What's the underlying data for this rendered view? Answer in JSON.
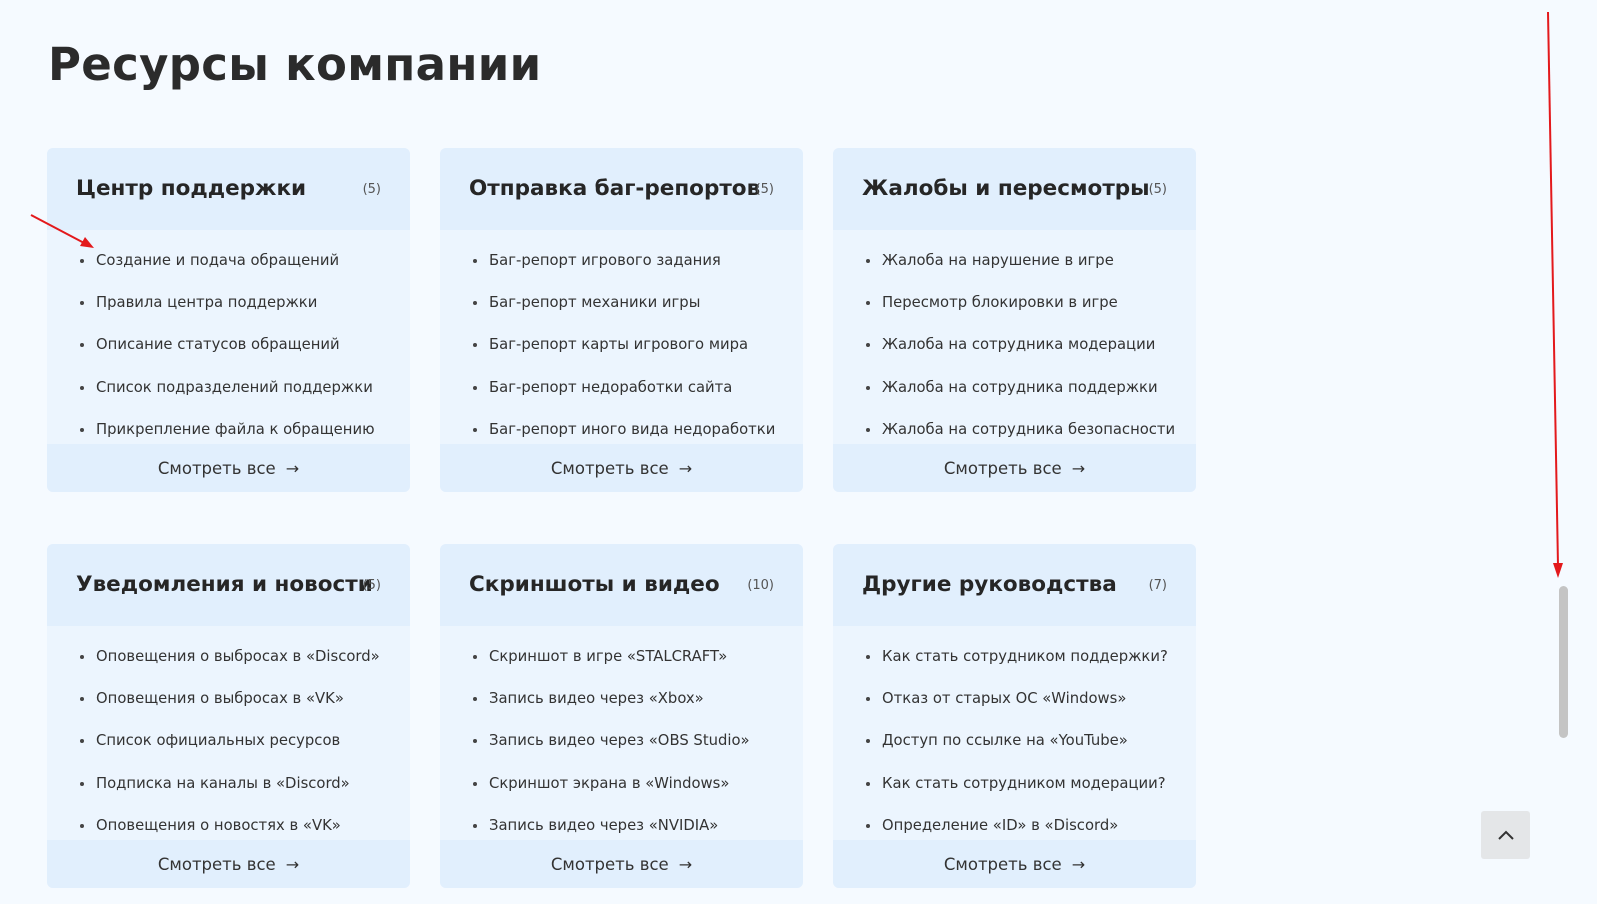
{
  "page": {
    "title": "Ресурсы компании"
  },
  "colors": {
    "background": "#f5faff",
    "card": "#ecf5fe",
    "card_header": "#e1effd",
    "annotation_arrow": "#e3191c"
  },
  "cards": [
    {
      "title": "Центр поддержки",
      "count": "(5)",
      "items": [
        "Создание и подача обращений",
        "Правила центра поддержки",
        "Описание статусов обращений",
        "Список подразделений поддержки",
        "Прикрепление файла к обращению"
      ],
      "view_all": "Смотреть все",
      "arrow": "→"
    },
    {
      "title": "Отправка баг-репортов",
      "count": "(5)",
      "items": [
        "Баг-репорт игрового задания",
        "Баг-репорт механики игры",
        "Баг-репорт карты игрового мира",
        "Баг-репорт недоработки сайта",
        "Баг-репорт иного вида недоработки"
      ],
      "view_all": "Смотреть все",
      "arrow": "→"
    },
    {
      "title": "Жалобы и пересмотры",
      "count": "(5)",
      "items": [
        "Жалоба на нарушение в игре",
        "Пересмотр блокировки в игре",
        "Жалоба на сотрудника модерации",
        "Жалоба на сотрудника поддержки",
        "Жалоба на сотрудника безопасности"
      ],
      "view_all": "Смотреть все",
      "arrow": "→"
    },
    {
      "title": "Уведомления и новости",
      "count": "(5)",
      "items": [
        "Оповещения о выбросах в «Discord»",
        "Оповещения о выбросах в «VK»",
        "Список официальных ресурсов",
        "Подписка на каналы в «Discord»",
        "Оповещения о новостях в «VK»"
      ],
      "view_all": "Смотреть все",
      "arrow": "→"
    },
    {
      "title": "Скриншоты и видео",
      "count": "(10)",
      "items": [
        "Скриншот в игре «STALCRAFT»",
        "Запись видео через «Xbox»",
        "Запись видео через «OBS Studio»",
        "Скриншот экрана в «Windows»",
        "Запись видео через «NVIDIA»"
      ],
      "view_all": "Смотреть все",
      "arrow": "→"
    },
    {
      "title": "Другие руководства",
      "count": "(7)",
      "items": [
        "Как стать сотрудником поддержки?",
        "Отказ от старых ОС «Windows»",
        "Доступ по ссылке на «YouTube»",
        "Как стать сотрудником модерации?",
        "Определение «ID» в «Discord»"
      ],
      "view_all": "Смотреть все",
      "arrow": "→"
    }
  ],
  "scroll": {
    "to_top_icon": "chevron-up-icon"
  }
}
